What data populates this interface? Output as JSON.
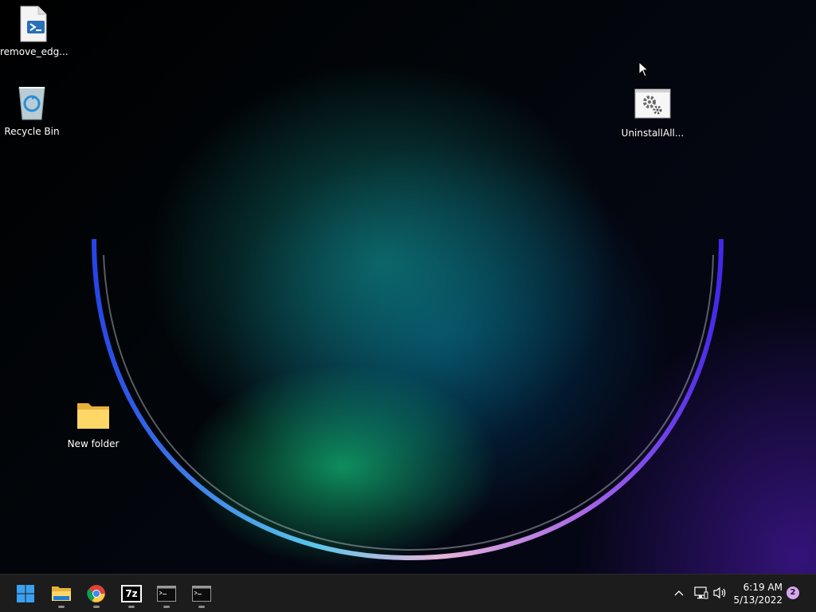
{
  "desktop": {
    "icons": [
      {
        "label": "remove_edg...",
        "icon": "powershell-script-icon"
      },
      {
        "label": "Recycle Bin",
        "icon": "recycle-bin-icon"
      },
      {
        "label": "UninstallAll...",
        "icon": "batch-file-gears-icon"
      },
      {
        "label": "New folder",
        "icon": "folder-icon"
      }
    ]
  },
  "taskbar": {
    "apps": [
      {
        "name": "Start",
        "icon": "windows-start-icon"
      },
      {
        "name": "File Explorer",
        "icon": "file-explorer-icon"
      },
      {
        "name": "Google Chrome",
        "icon": "chrome-icon"
      },
      {
        "name": "7-Zip",
        "icon": "7zip-icon",
        "glyph": "7z"
      },
      {
        "name": "Command Prompt",
        "icon": "terminal-icon"
      },
      {
        "name": "Command Prompt",
        "icon": "terminal-icon"
      }
    ],
    "tray": {
      "time": "6:19 AM",
      "date": "5/13/2022",
      "notification_count": "2"
    }
  },
  "colors": {
    "taskbar_bg": "#1c1c1c",
    "accent": "#0a84d8",
    "badge": "#d6a6ef"
  }
}
